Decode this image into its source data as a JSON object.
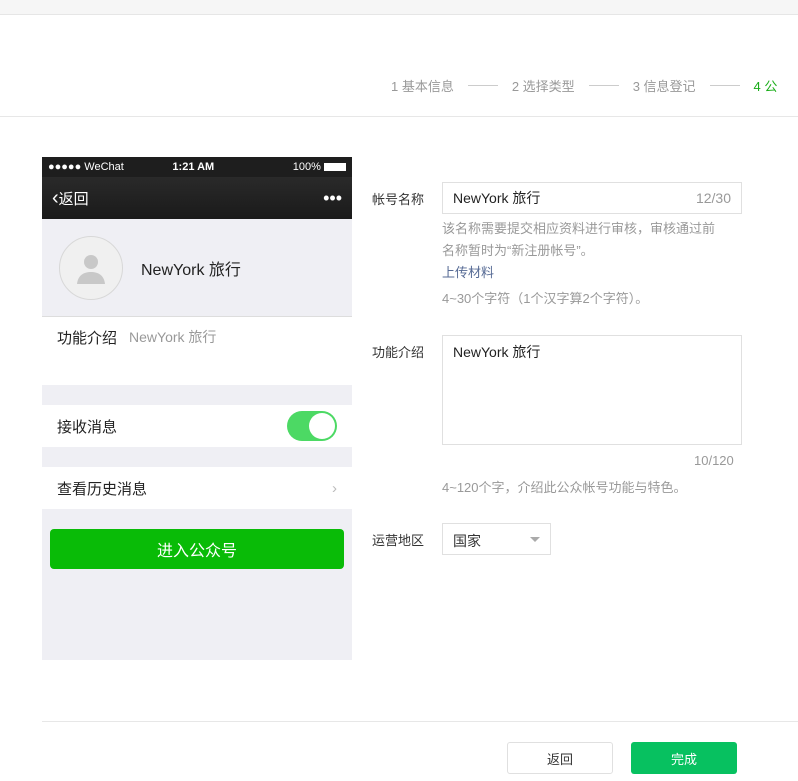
{
  "steps": [
    "1 基本信息",
    "2 选择类型",
    "3 信息登记",
    "4 公"
  ],
  "phone": {
    "carrier": "●●●●● WeChat",
    "time": "1:21 AM",
    "battery": "100%",
    "back": "返回",
    "more": "•••",
    "name": "NewYork 旅行",
    "intro_label": "功能介绍",
    "intro_value": "NewYork 旅行",
    "receive": "接收消息",
    "receive_on": true,
    "history": "查看历史消息",
    "enter": "进入公众号"
  },
  "form": {
    "name_label": "帐号名称",
    "name_value": "NewYork 旅行",
    "name_count": "12/30",
    "name_hint1": "该名称需要提交相应资料进行审核，审核通过前",
    "name_hint2": "名称暂时为“新注册帐号”。",
    "upload": "上传材料",
    "name_rule": "4~30个字符（1个汉字算2个字符）。",
    "intro_label": "功能介绍",
    "intro_value": "NewYork 旅行",
    "intro_count": "10/120",
    "intro_rule": "4~120个字，介绍此公众帐号功能与特色。",
    "region_label": "运营地区",
    "region_value": "国家"
  },
  "buttons": {
    "back": "返回",
    "done": "完成"
  },
  "colors": {
    "accent": "#07c160"
  }
}
